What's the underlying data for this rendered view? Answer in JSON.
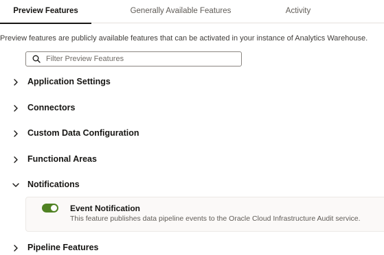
{
  "tabs": [
    {
      "label": "Preview Features",
      "active": true
    },
    {
      "label": "Generally Available Features",
      "active": false
    },
    {
      "label": "Activity",
      "active": false
    }
  ],
  "intro_text": "Preview features are publicly available features that can be activated in your instance of Analytics Warehouse.",
  "search": {
    "placeholder": "Filter Preview Features",
    "value": ""
  },
  "sections": [
    {
      "label": "Application Settings",
      "expanded": false
    },
    {
      "label": "Connectors",
      "expanded": false
    },
    {
      "label": "Custom Data Configuration",
      "expanded": false
    },
    {
      "label": "Functional Areas",
      "expanded": false
    },
    {
      "label": "Notifications",
      "expanded": true
    },
    {
      "label": "Pipeline Features",
      "expanded": false
    }
  ],
  "notifications_features": [
    {
      "title": "Event Notification",
      "description": "This feature publishes data pipeline events to the Oracle Cloud Infrastructure Audit service.",
      "enabled": true
    }
  ],
  "colors": {
    "toggle_on": "#508223",
    "text": "#161513",
    "muted": "#5f5b56"
  },
  "icons": {
    "search": "search-icon",
    "collapsed": "chevron-right-icon",
    "expanded": "chevron-down-icon"
  }
}
